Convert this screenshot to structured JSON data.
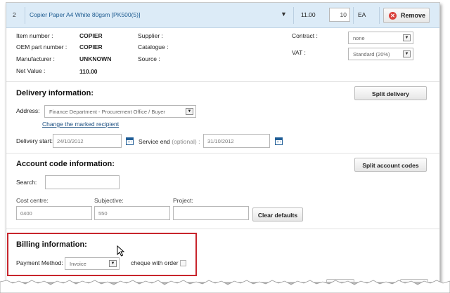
{
  "line_item": {
    "number": "2",
    "description": "Copier Paper A4 White 80gsm [PK500(5)]",
    "expand_glyph": "▼",
    "price": "11.00",
    "quantity": "10",
    "unit": "EA",
    "remove_label": "Remove"
  },
  "details": {
    "item_number_label": "Item number :",
    "item_number_value": "COPIER",
    "oem_label": "OEM part number :",
    "oem_value": "COPIER",
    "manufacturer_label": "Manufacturer :",
    "manufacturer_value": "UNKNOWN",
    "net_value_label": "Net Value :",
    "net_value_value": "110.00",
    "supplier_label": "Supplier :",
    "catalogue_label": "Catalogue :",
    "source_label": "Source :",
    "contract_label": "Contract :",
    "contract_value": "none",
    "vat_label": "VAT :",
    "vat_value": "Standard (20%)"
  },
  "delivery": {
    "title": "Delivery information:",
    "split_button": "Split delivery",
    "address_label": "Address:",
    "address_value": "Finance Department - Procurement Office / Buyer",
    "change_link": "Change the marked recipient",
    "start_label": "Delivery start:",
    "start_value": "24/10/2012",
    "end_label": "Service end",
    "end_optional": "(optional) :",
    "end_value": "31/10/2012"
  },
  "account": {
    "title": "Account code information:",
    "split_button": "Split account codes",
    "search_label": "Search:",
    "search_value": "",
    "cost_centre_label": "Cost centre:",
    "cost_centre_value": "0400",
    "subjective_label": "Subjective:",
    "subjective_value": "550",
    "project_label": "Project:",
    "project_value": "",
    "clear_button": "Clear defaults"
  },
  "billing": {
    "title": "Billing information:",
    "payment_label": "Payment Method:",
    "payment_value": "Invoice",
    "cheque_label": "cheque with order",
    "cheque_checked": false
  },
  "colors": {
    "header_bg": "#dcebf7",
    "link": "#1a4e80",
    "highlight_border": "#c8252c",
    "remove_icon": "#d9403b"
  }
}
